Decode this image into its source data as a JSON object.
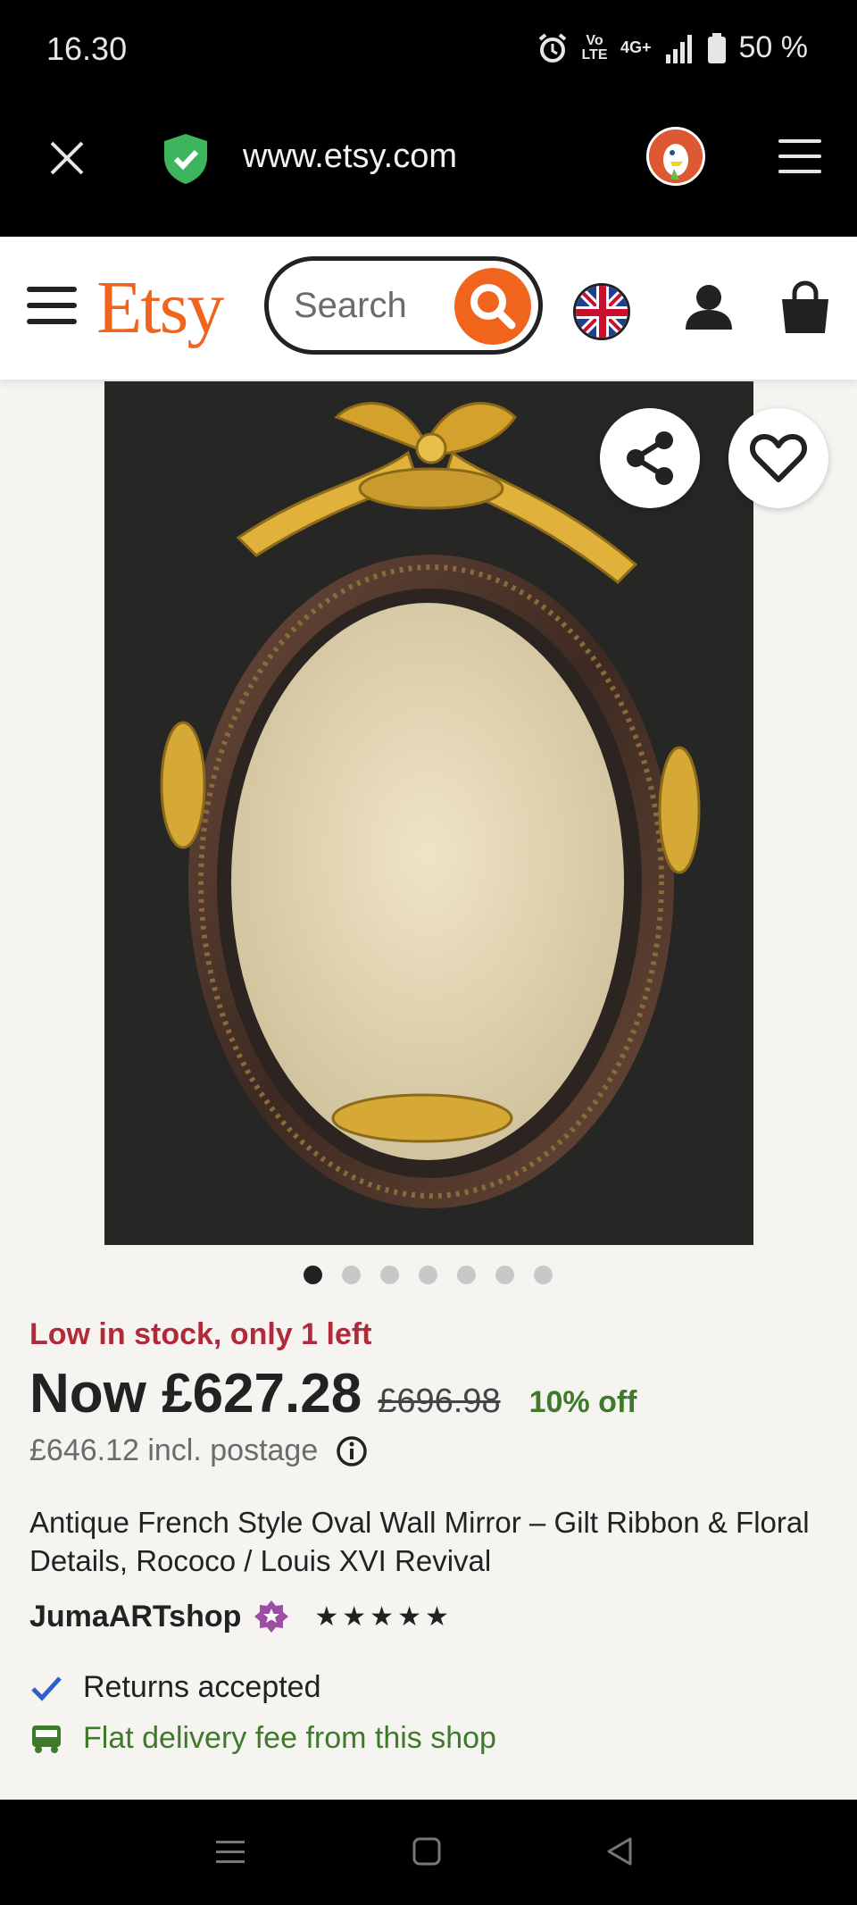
{
  "status_bar": {
    "time": "16.30",
    "network": "4G+",
    "volte": "Vo LTE",
    "battery": "50 %"
  },
  "browser": {
    "url": "www.etsy.com"
  },
  "header": {
    "logo": "Etsy",
    "search_placeholder": "Search"
  },
  "product": {
    "image_count": 7,
    "active_image": 1,
    "stock_text": "Low in stock, only 1 left",
    "price_now": "Now £627.28",
    "price_original": "£696.98",
    "discount": "10% off",
    "postage_text": "£646.12 incl. postage",
    "title": "Antique French Style Oval Wall Mirror – Gilt Ribbon & Floral Details, Rococo / Louis XVI Revival",
    "shop_name": "JumaARTshop",
    "rating_stars": "★★★★★",
    "rating_value": 5,
    "returns_text": "Returns accepted",
    "delivery_text": "Flat delivery fee from this shop"
  },
  "colors": {
    "brand": "#f1641e",
    "stock_alert": "#b12a3a",
    "discount": "#3f7a2b",
    "shop_badge": "#9b4ea3"
  }
}
